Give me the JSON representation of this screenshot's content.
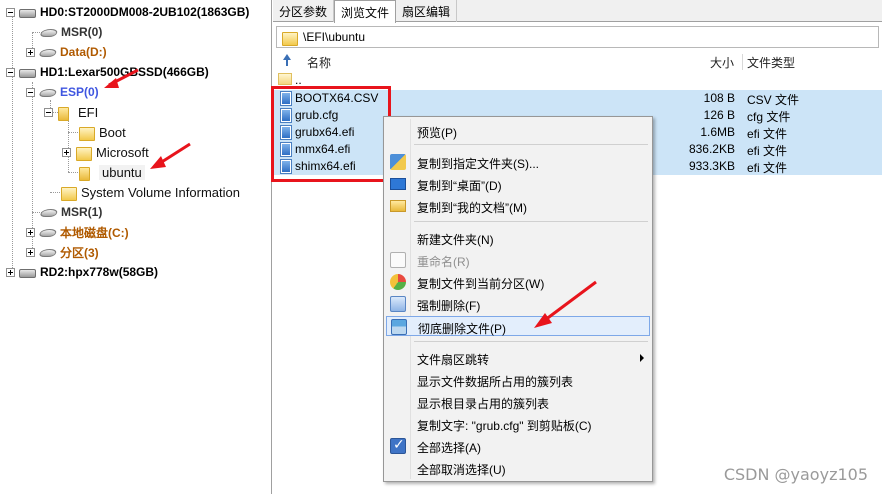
{
  "tree": {
    "hd0": "HD0:ST2000DM008-2UB102(1863GB)",
    "hd0_msr": "MSR(0)",
    "hd0_data": "Data(D:)",
    "hd1": "HD1:Lexar500GBSSD(466GB)",
    "esp": "ESP(0)",
    "efi": "EFI",
    "boot": "Boot",
    "microsoft": "Microsoft",
    "ubuntu": "ubuntu",
    "svi": "System Volume Information",
    "hd1_msr": "MSR(1)",
    "local_disk": "本地磁盘(C:)",
    "partition3": "分区(3)",
    "rd2": "RD2:hpx778w(58GB)"
  },
  "tabs": [
    "分区参数",
    "浏览文件",
    "扇区编辑"
  ],
  "path": "\\EFI\\ubuntu",
  "columns": {
    "name": "名称",
    "size": "大小",
    "type": "文件类型"
  },
  "parent_row": "..",
  "files": [
    {
      "name": "BOOTX64.CSV",
      "size": "108 B",
      "type": "CSV 文件"
    },
    {
      "name": "grub.cfg",
      "size": "126 B",
      "type": "cfg 文件"
    },
    {
      "name": "grubx64.efi",
      "size": "1.6MB",
      "type": "efi 文件"
    },
    {
      "name": "mmx64.efi",
      "size": "836.2KB",
      "type": "efi 文件"
    },
    {
      "name": "shimx64.efi",
      "size": "933.3KB",
      "type": "efi 文件"
    }
  ],
  "menu": {
    "preview": "预览(P)",
    "copy_to_folder": "复制到指定文件夹(S)...",
    "copy_to_desktop": "复制到“桌面”(D)",
    "copy_to_mydocs": "复制到“我的文档”(M)",
    "new_folder": "新建文件夹(N)",
    "rename": "重命名(R)",
    "copy_to_partition": "复制文件到当前分区(W)",
    "force_delete": "强制删除(F)",
    "shred_delete": "彻底删除文件(P)",
    "sector_jump": "文件扇区跳转",
    "show_cluster_list": "显示文件数据所占用的簇列表",
    "show_root_cluster": "显示根目录占用的簇列表",
    "copy_text": "复制文字: \"grub.cfg\" 到剪贴板(C)",
    "select_all": "全部选择(A)",
    "deselect_all": "全部取消选择(U)"
  },
  "watermark": "CSDN @yaoyz105",
  "colors": {
    "annotation": "#e8141c",
    "selection": "#cce4f7",
    "esp_label": "#3f56e0",
    "partition_label": "#b05a00"
  }
}
